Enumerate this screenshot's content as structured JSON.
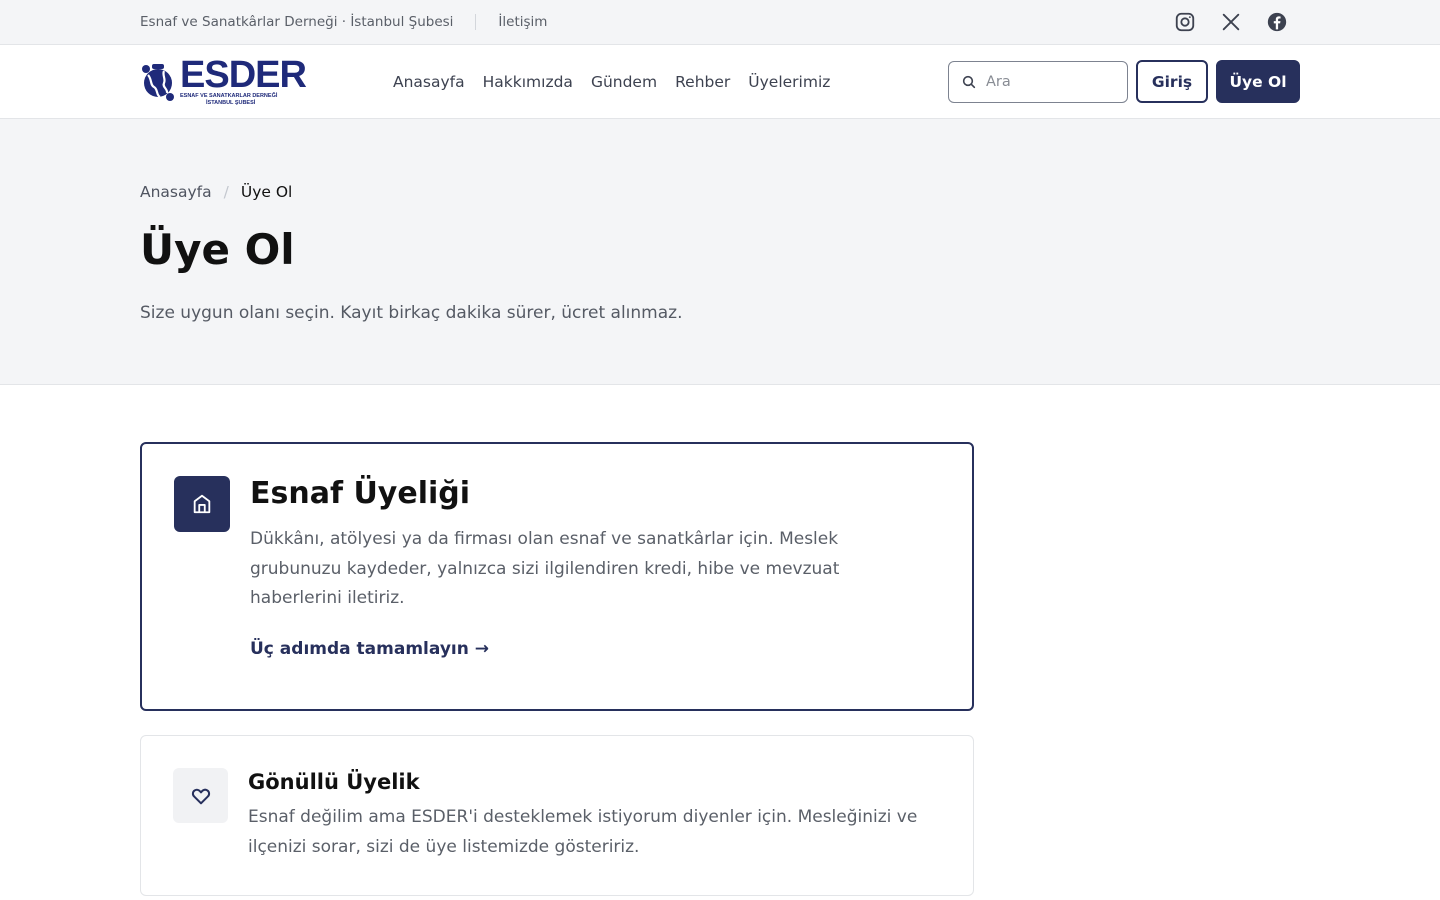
{
  "topbar": {
    "org_name": "Esnaf ve Sanatkârlar Derneği · İstanbul Şubesi",
    "contact": "İletişim",
    "social": [
      "instagram-icon",
      "x-icon",
      "facebook-icon"
    ]
  },
  "header": {
    "logo": {
      "wordmark": "ESDER",
      "subtitle_1": "ESNAF VE SANATKARLAR DERNEĞİ",
      "subtitle_2": "İSTANBUL ŞUBESİ"
    },
    "nav": [
      "Anasayfa",
      "Hakkımızda",
      "Gündem",
      "Rehber",
      "Üyelerimiz"
    ],
    "search_placeholder": "Ara",
    "login_label": "Giriş",
    "signup_label": "Üye Ol"
  },
  "hero": {
    "breadcrumb": [
      "Anasayfa",
      "Üye Ol"
    ],
    "breadcrumb_sep": "/",
    "title": "Üye Ol",
    "subtitle": "Size uygun olanı seçin. Kayıt birkaç dakika sürer, ücret alınmaz."
  },
  "cards": [
    {
      "icon": "storefront-icon",
      "title": "Esnaf Üyeliği",
      "description": "Dükkânı, atölyesi ya da firması olan esnaf ve sanatkârlar için. Meslek grubunuzu kaydeder, yalnızca sizi ilgilendiren kredi, hibe ve mevzuat haberlerini iletiriz.",
      "cta": "Üç adımda tamamlayın →"
    },
    {
      "icon": "heart-icon",
      "title": "Gönüllü Üyelik",
      "description": "Esnaf değilim ama ESDER'i desteklemek istiyorum diyenler için. Mesleğinizi ve ilçenizi sorar, sizi de üye listemizde gösteririz."
    }
  ],
  "colors": {
    "primary": "#27305c",
    "logo_blue": "#1f2a7a",
    "muted_bg": "#f4f5f7"
  }
}
